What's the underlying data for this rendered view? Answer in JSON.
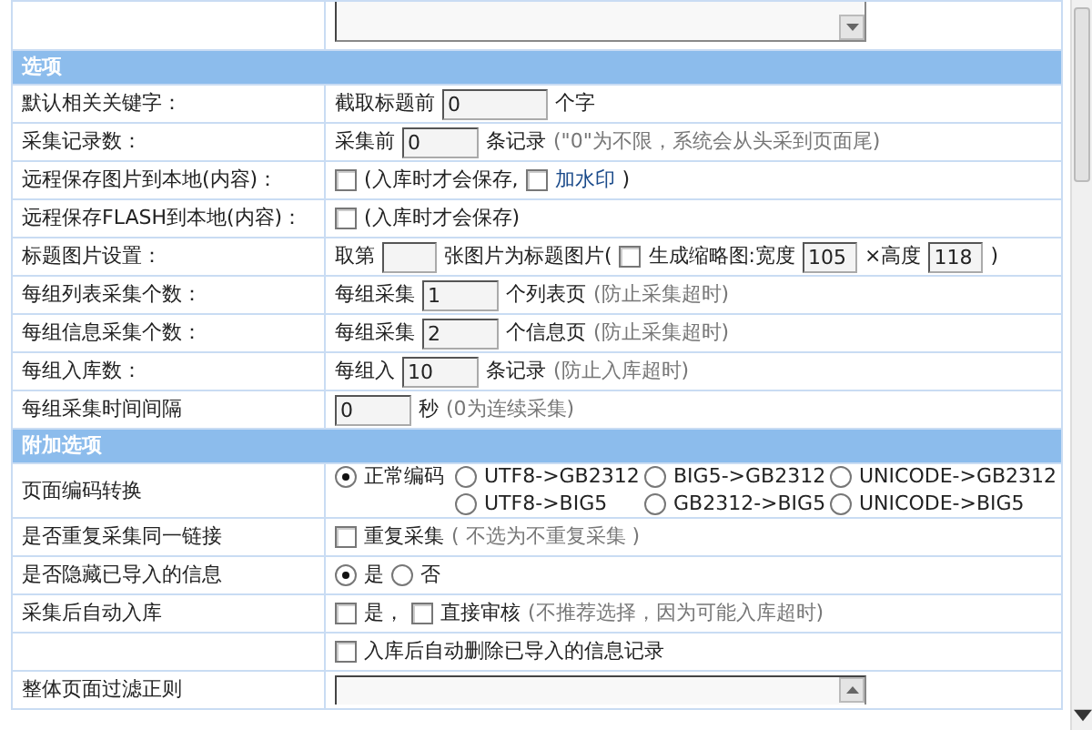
{
  "sections": [
    {
      "rows": [
        {
          "parts": [
            {
              "kind": "textarea-bottom"
            }
          ]
        }
      ]
    },
    {
      "title": "选项",
      "rows": [
        {
          "label": "默认相关关键字：",
          "parts": [
            {
              "kind": "text",
              "text": "截取标题前"
            },
            {
              "kind": "wide-input",
              "value": "0"
            },
            {
              "kind": "text",
              "text": "个字"
            }
          ]
        },
        {
          "label": "采集记录数：",
          "parts": [
            {
              "kind": "text",
              "text": "采集前"
            },
            {
              "kind": "input",
              "value": "0"
            },
            {
              "kind": "text",
              "text": "条记录"
            },
            {
              "kind": "hint",
              "text": "(\"0\"为不限，系统会从头采到页面尾)"
            }
          ]
        },
        {
          "label": "远程保存图片到本地(内容)：",
          "parts": [
            {
              "kind": "checkbox",
              "checked": false
            },
            {
              "kind": "text",
              "text": "(入库时才会保存,"
            },
            {
              "kind": "checkbox",
              "checked": false
            },
            {
              "kind": "link",
              "text": "加水印"
            },
            {
              "kind": "text",
              "text": ")"
            }
          ]
        },
        {
          "label": "远程保存FLASH到本地(内容)：",
          "parts": [
            {
              "kind": "checkbox",
              "checked": false
            },
            {
              "kind": "text",
              "text": "(入库时才会保存)"
            }
          ]
        },
        {
          "label": "标题图片设置：",
          "parts": [
            {
              "kind": "text",
              "text": "取第"
            },
            {
              "kind": "narrow-input"
            },
            {
              "kind": "text",
              "text": "张图片为标题图片("
            },
            {
              "kind": "checkbox",
              "checked": false
            },
            {
              "kind": "text",
              "text": "生成缩略图:宽度"
            },
            {
              "kind": "narrow-input",
              "value": "105"
            },
            {
              "kind": "text",
              "text": "×高度"
            },
            {
              "kind": "narrow-input",
              "value": "118"
            },
            {
              "kind": "text",
              "text": ")"
            }
          ]
        },
        {
          "label": "每组列表采集个数：",
          "parts": [
            {
              "kind": "text",
              "text": "每组采集"
            },
            {
              "kind": "input",
              "value": "1"
            },
            {
              "kind": "text",
              "text": "个列表页"
            },
            {
              "kind": "hint",
              "text": "(防止采集超时)"
            }
          ]
        },
        {
          "label": "每组信息采集个数：",
          "parts": [
            {
              "kind": "text",
              "text": "每组采集"
            },
            {
              "kind": "input",
              "value": "2"
            },
            {
              "kind": "text",
              "text": "个信息页"
            },
            {
              "kind": "hint",
              "text": "(防止采集超时)"
            }
          ]
        },
        {
          "label": "每组入库数：",
          "parts": [
            {
              "kind": "text",
              "text": "每组入"
            },
            {
              "kind": "input",
              "value": "10"
            },
            {
              "kind": "text",
              "text": "条记录"
            },
            {
              "kind": "hint",
              "text": "(防止入库超时)"
            }
          ]
        },
        {
          "label": "每组采集时间间隔",
          "parts": [
            {
              "kind": "input",
              "value": "0"
            },
            {
              "kind": "text",
              "text": "秒"
            },
            {
              "kind": "hint",
              "text": "(0为连续采集)"
            }
          ]
        }
      ]
    },
    {
      "title": "附加选项",
      "rows": [
        {
          "label": "页面编码转换",
          "parts": [
            {
              "kind": "radiogrid",
              "options": [
                {
                  "label": "正常编码",
                  "selected": true
                },
                {
                  "label": "UTF8->GB2312",
                  "selected": false
                },
                {
                  "label": "BIG5->GB2312",
                  "selected": false
                },
                {
                  "label": "UNICODE->GB2312",
                  "selected": false
                },
                {
                  "label": "UTF8->BIG5",
                  "selected": false
                },
                {
                  "label": "GB2312->BIG5",
                  "selected": false
                },
                {
                  "label": "UNICODE->BIG5",
                  "selected": false
                }
              ]
            }
          ]
        },
        {
          "label": "是否重复采集同一链接",
          "parts": [
            {
              "kind": "checkbox",
              "checked": false
            },
            {
              "kind": "text",
              "text": "重复采集"
            },
            {
              "kind": "hint",
              "text": "( 不选为不重复采集 )"
            }
          ]
        },
        {
          "label": "是否隐藏已导入的信息",
          "parts": [
            {
              "kind": "radio",
              "label": "是",
              "selected": true
            },
            {
              "kind": "radio",
              "label": "否",
              "selected": false
            }
          ]
        },
        {
          "label": "采集后自动入库",
          "parts": [
            {
              "kind": "checkbox",
              "checked": false
            },
            {
              "kind": "text",
              "text": "是，"
            },
            {
              "kind": "checkbox",
              "checked": false
            },
            {
              "kind": "text",
              "text": "直接审核"
            },
            {
              "kind": "hint",
              "text": "(不推荐选择，因为可能入库超时)"
            }
          ]
        },
        {
          "parts": [
            {
              "kind": "checkbox",
              "checked": false
            },
            {
              "kind": "text",
              "text": "入库后自动删除已导入的信息记录"
            }
          ]
        },
        {
          "label": "整体页面过滤正则",
          "parts": [
            {
              "kind": "textarea-top"
            }
          ]
        }
      ]
    }
  ]
}
